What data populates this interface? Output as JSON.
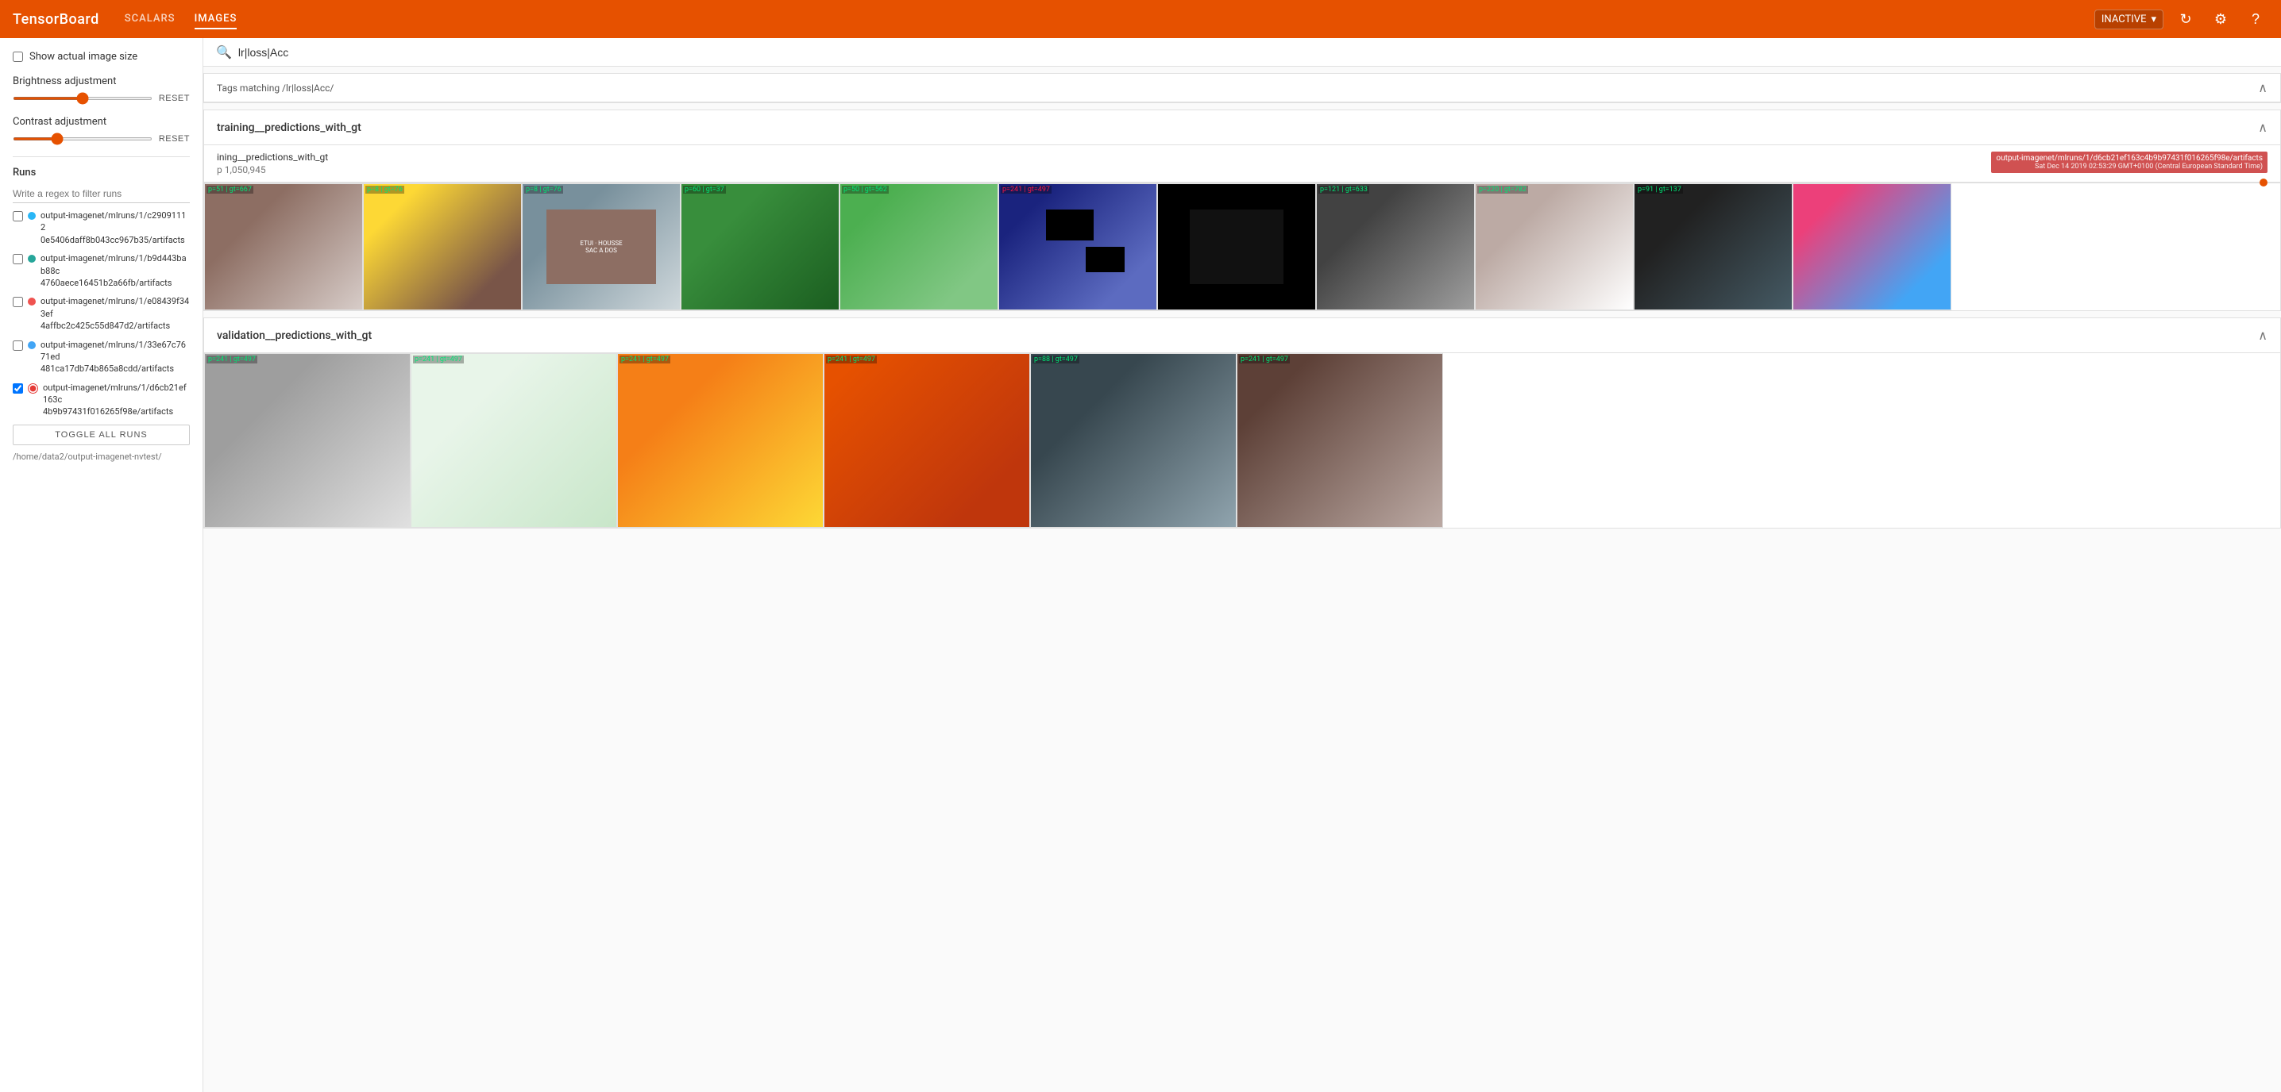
{
  "nav": {
    "brand": "TensorBoard",
    "links": [
      {
        "label": "SCALARS",
        "active": false
      },
      {
        "label": "IMAGES",
        "active": true
      }
    ],
    "right": {
      "status": "INACTIVE",
      "refresh_icon": "↻",
      "settings_icon": "⚙",
      "help_icon": "?"
    }
  },
  "sidebar": {
    "show_actual_size_label": "Show actual image size",
    "brightness_label": "Brightness adjustment",
    "brightness_value": 50,
    "brightness_reset": "RESET",
    "contrast_label": "Contrast adjustment",
    "contrast_value": 30,
    "contrast_reset": "RESET",
    "runs_title": "Runs",
    "runs_filter_placeholder": "Write a regex to filter runs",
    "toggle_all_label": "TOGGLE ALL RUNS",
    "data_dir": "/home/data2/output-imagenet-nvtest/",
    "runs": [
      {
        "id": "run1",
        "color": "#29b6f6",
        "label": "output-imagenet/mlruns/1/c29091112​0e5406daff8b043cc967b35/artifacts",
        "checked": false,
        "active_radio": false
      },
      {
        "id": "run2",
        "color": "#26a69a",
        "label": "output-imagenet/mlruns/1/b9d443bab88c4760aece16451b2a66fb/artifacts",
        "checked": false,
        "active_radio": false
      },
      {
        "id": "run3",
        "color": "#ef5350",
        "label": "output-imagenet/mlruns/1/e08439f343ef4affbc2c425c55d847d2/artifacts",
        "checked": false,
        "active_radio": false
      },
      {
        "id": "run4",
        "color": "#42a5f5",
        "label": "output-imagenet/mlruns/1/33e67c7671ed481ca17db74b865a8cdd/artifacts",
        "checked": false,
        "active_radio": false
      },
      {
        "id": "run5",
        "color": "#e53935",
        "label": "output-imagenet/mlruns/1/d6cb21ef163c4b9b97431f016265f98e/artifacts",
        "checked": true,
        "active_radio": true
      }
    ]
  },
  "search": {
    "placeholder": "lr|loss|Acc",
    "value": "lr|loss|Acc"
  },
  "tags_section": {
    "label": "Tags matching /lr|loss|Acc/"
  },
  "training_section": {
    "title": "training__predictions_with_gt",
    "run_name": "ining__predictions_with_gt",
    "step_prefix": "p",
    "step_value": "1,050,945",
    "tooltip_line1": "output-imagenet/mlruns/1/d6cb21ef163c4b9b97431f016265f98e/artifacts",
    "tooltip_line2": "Sat Dec 14 2019 02:53:29 GMT+0100 (Central European Standard Time)",
    "images": [
      {
        "label": "p=51 | gt=667",
        "type": "dog"
      },
      {
        "label": "p=8 | gt=76",
        "type": "sax"
      },
      {
        "label": "p=8 | gt=76",
        "type": "store"
      },
      {
        "label": "p=60 | gt=37",
        "type": "snake"
      },
      {
        "label": "p=50 | gt=562",
        "type": "fountain"
      },
      {
        "label": "p=241 | gt=497",
        "type": "blue"
      },
      {
        "label": "",
        "type": "black1"
      },
      {
        "label": "p=121 | gt=633",
        "type": "lens"
      },
      {
        "label": "p=220 | gt=782",
        "type": "room"
      },
      {
        "label": "p=91 | gt=137",
        "type": "insect"
      },
      {
        "label": "",
        "type": "colorful"
      }
    ]
  },
  "validation_section": {
    "title": "validation__predictions_with_gt",
    "images": [
      {
        "label": "p=241 | gt=497",
        "type": "church-grey"
      },
      {
        "label": "p=241 | gt=497",
        "type": "church-white"
      },
      {
        "label": "p=241 | gt=497",
        "type": "church-gold"
      },
      {
        "label": "p=241 | gt=497",
        "type": "church-baroque"
      },
      {
        "label": "p=88 | gt=497",
        "type": "church-dome"
      },
      {
        "label": "p=241 | gt=497",
        "type": "cathedral"
      }
    ]
  }
}
